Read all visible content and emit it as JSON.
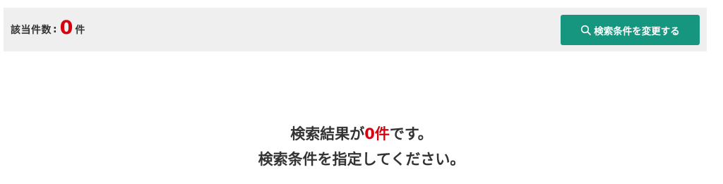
{
  "result_bar": {
    "count_label": "該当件数",
    "colon": ":",
    "count_value": "0",
    "count_unit": "件",
    "change_button_label": "検索条件を変更する",
    "button_icon": "search-icon"
  },
  "empty_message": {
    "line1_prefix": "検索結果が",
    "line1_count": "0件",
    "line1_suffix": "です。",
    "line2": "検索条件を指定してください。"
  },
  "colors": {
    "accent_green": "#16967f",
    "count_red": "#d7000f",
    "bar_background": "#efefef",
    "text_dark": "#333333"
  }
}
